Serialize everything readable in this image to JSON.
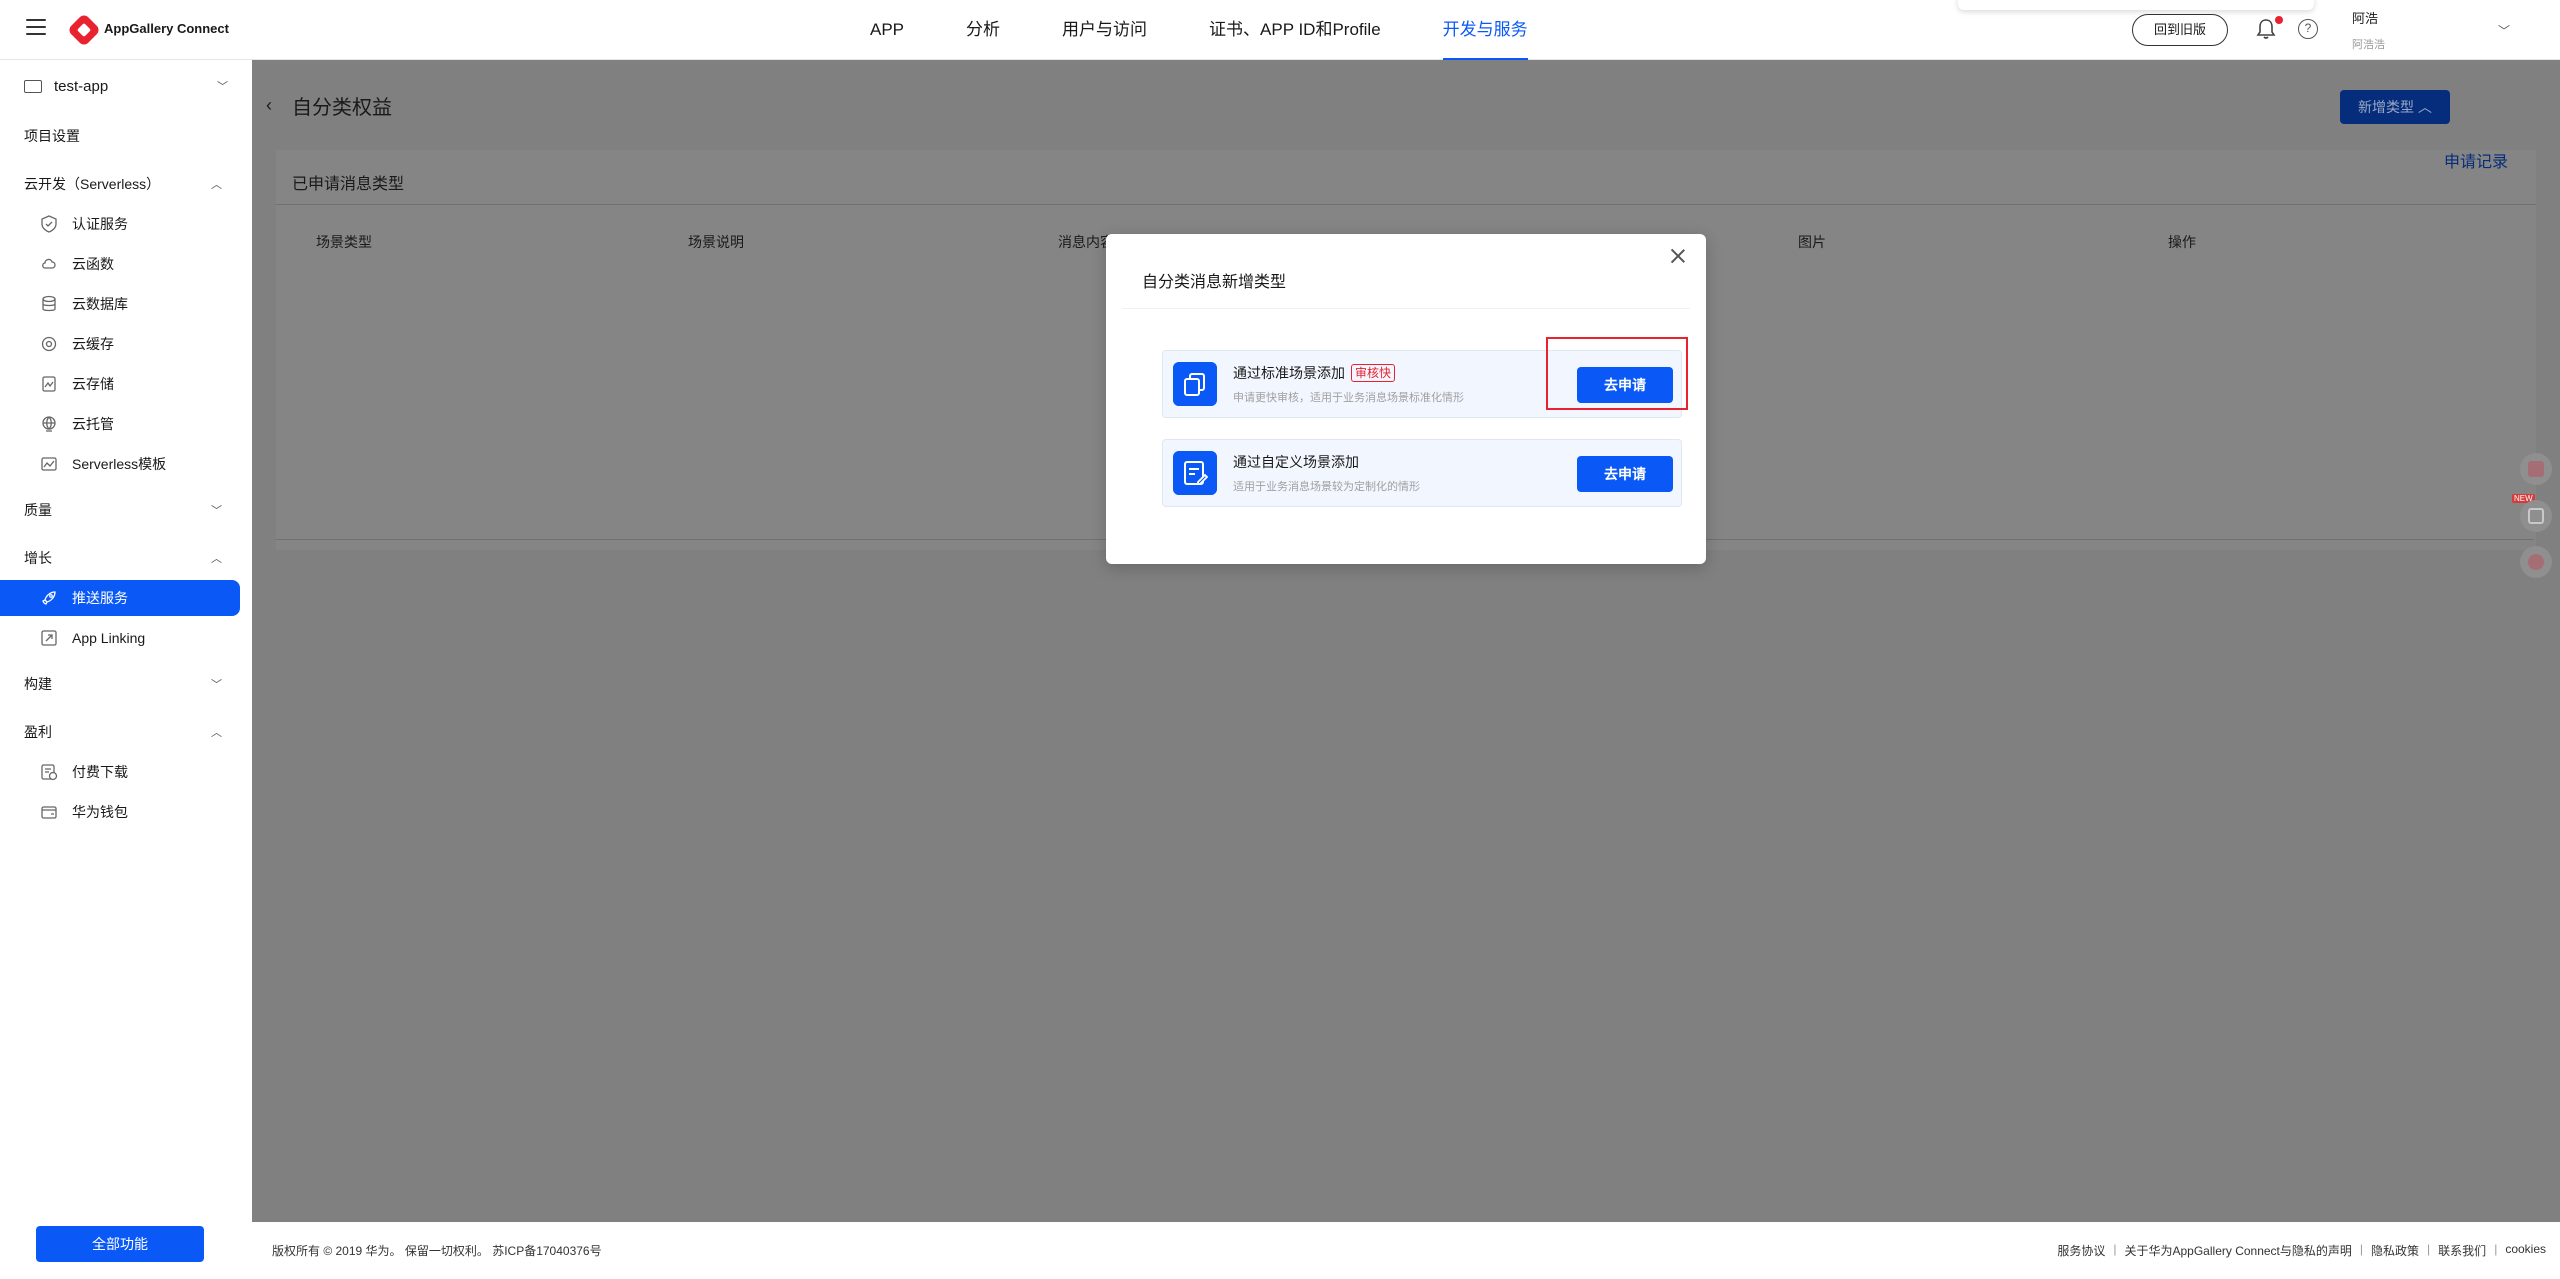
{
  "header": {
    "brand": "AppGallery Connect",
    "nav": [
      {
        "label": "APP"
      },
      {
        "label": "分析"
      },
      {
        "label": "用户与访问"
      },
      {
        "label": "证书、APP ID和Profile"
      },
      {
        "label": "开发与服务",
        "active": true
      }
    ],
    "back_old_label": "回到旧版",
    "help_glyph": "?",
    "user_name": "阿浩",
    "user_sub": "阿浩浩"
  },
  "sidebar": {
    "project_name": "test-app",
    "project_settings": "项目设置",
    "groups": {
      "serverless": "云开发（Serverless）",
      "quality": "质量",
      "growth": "增长",
      "build": "构建",
      "earn": "盈利"
    },
    "items": {
      "auth": "认证服务",
      "functions": "云函数",
      "database": "云数据库",
      "cache": "云缓存",
      "storage": "云存储",
      "hosting": "云托管",
      "serverless_template": "Serverless模板",
      "push": "推送服务",
      "applinking": "App Linking",
      "paid_download": "付费下载",
      "wallet": "华为钱包"
    },
    "all_features": "全部功能"
  },
  "main": {
    "title": "自分类权益",
    "new_type_button": "新增类型",
    "applied_title": "已申请消息类型",
    "apply_record": "申请记录",
    "columns": [
      "场景类型",
      "场景说明",
      "消息内容",
      "图片",
      "操作"
    ]
  },
  "modal": {
    "title": "自分类消息新增类型",
    "options": [
      {
        "title": "通过标准场景添加",
        "tag": "审核快",
        "desc": "申请更快审核，适用于业务消息场景标准化情形",
        "button": "去申请"
      },
      {
        "title": "通过自定义场景添加",
        "desc": "适用于业务消息场景较为定制化的情形",
        "button": "去申请"
      }
    ]
  },
  "footer": {
    "copyright": "版权所有 © 2019 华为。 保留一切权利。 苏ICP备17040376号",
    "links": [
      "服务协议",
      "关于华为AppGallery Connect与隐私的声明",
      "隐私政策",
      "联系我们",
      "cookies"
    ]
  },
  "floating": {
    "new_tag": "NEW"
  },
  "colors": {
    "accent": "#0a59f7",
    "danger": "#e8222f"
  }
}
